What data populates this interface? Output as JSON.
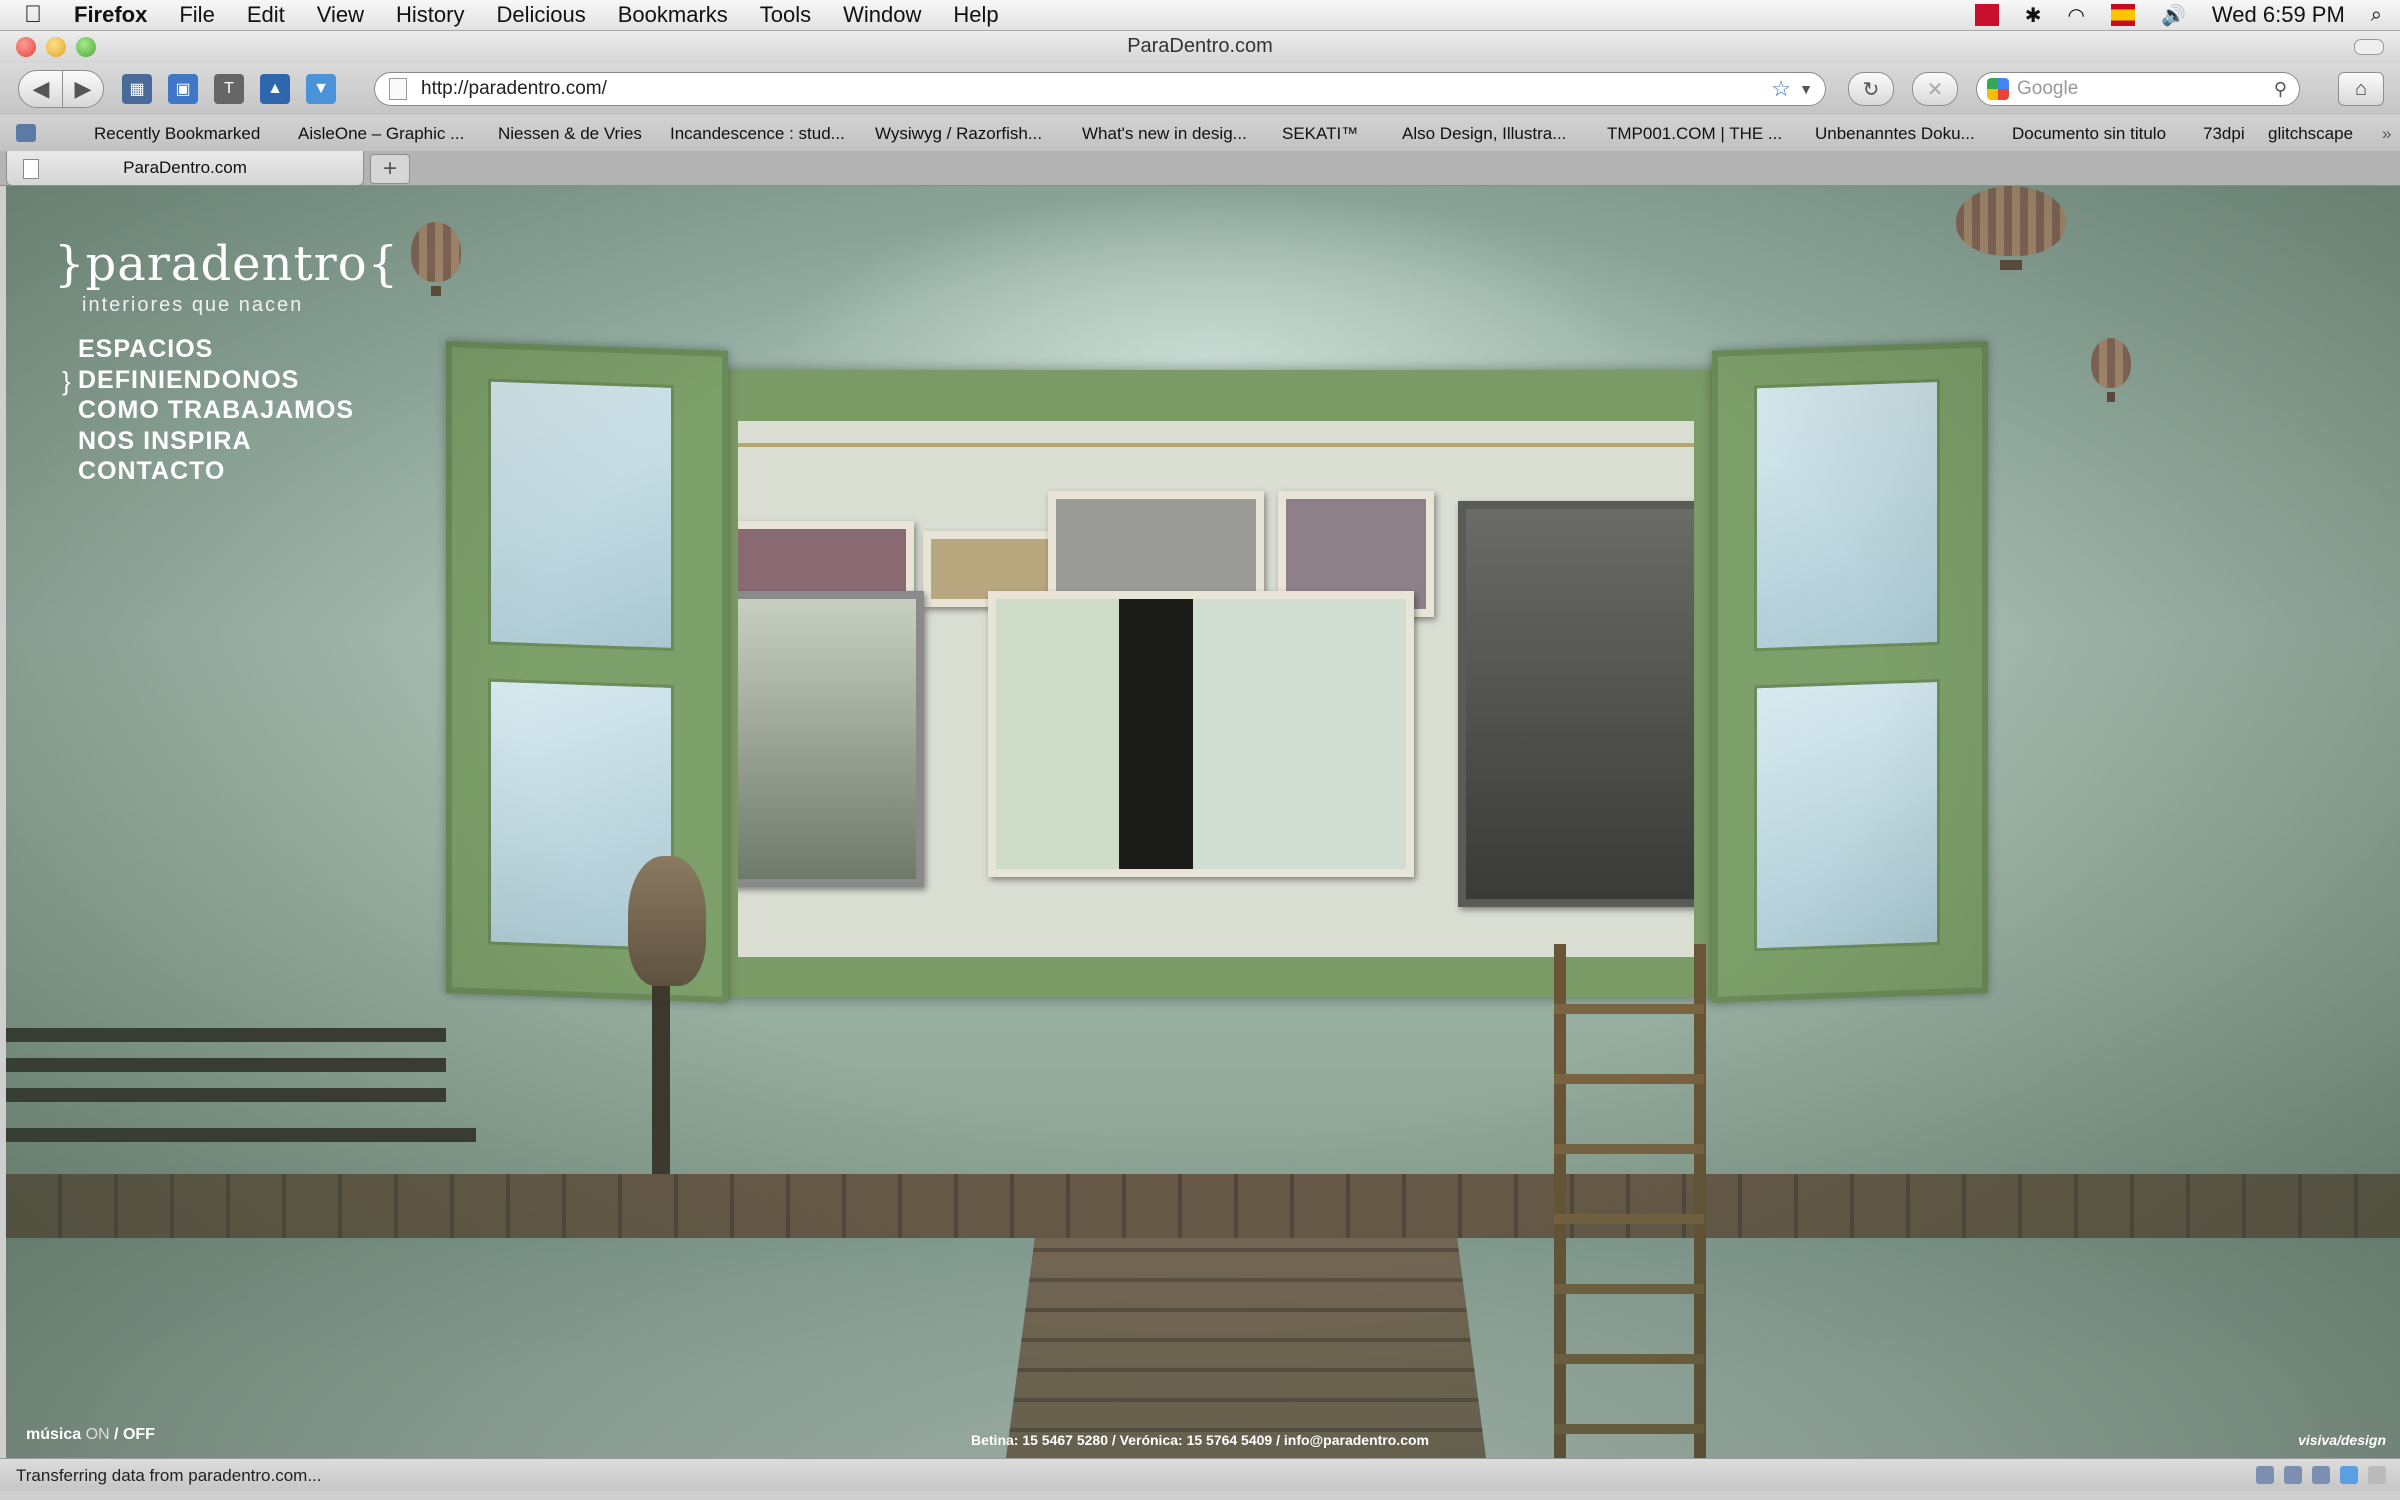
{
  "menubar": {
    "app_name": "Firefox",
    "items": [
      "File",
      "Edit",
      "View",
      "History",
      "Delicious",
      "Bookmarks",
      "Tools",
      "Window",
      "Help"
    ],
    "clock": "Wed 6:59 PM"
  },
  "window": {
    "title": "ParaDentro.com"
  },
  "navbar": {
    "url": "http://paradentro.com/",
    "search_placeholder": "Google"
  },
  "bookmarks": {
    "items": [
      "Recently Bookmarked",
      "AisleOne – Graphic ...",
      "Niessen & de Vries",
      "Incandescence : stud...",
      "Wysiwyg / Razorfish...",
      "What's new in desig...",
      "SEKATI™",
      "Also Design, Illustra...",
      "TMP001.COM | THE ...",
      "Unbenanntes Doku...",
      "Documento sin titulo",
      "73dpi",
      "glitchscape"
    ]
  },
  "tabs": {
    "active_label": "ParaDentro.com",
    "new_tab_label": "+"
  },
  "page": {
    "logo": "}paradentro{",
    "tagline": "interiores que nacen",
    "nav": [
      "ESPACIOS",
      "DEFINIENDONOS",
      "COMO TRABAJAMOS",
      "NOS INSPIRA",
      "CONTACTO"
    ],
    "nav_marker": "}",
    "music_label": "música",
    "music_on": "ON",
    "music_sep": " / ",
    "music_off": "OFF",
    "contacts": "Betina: 15 5467 5280  /  Verónica: 15 5764 5409  /  info@paradentro.com",
    "credit": "visiva/design"
  },
  "statusbar": {
    "message": "Transferring data from paradentro.com..."
  }
}
